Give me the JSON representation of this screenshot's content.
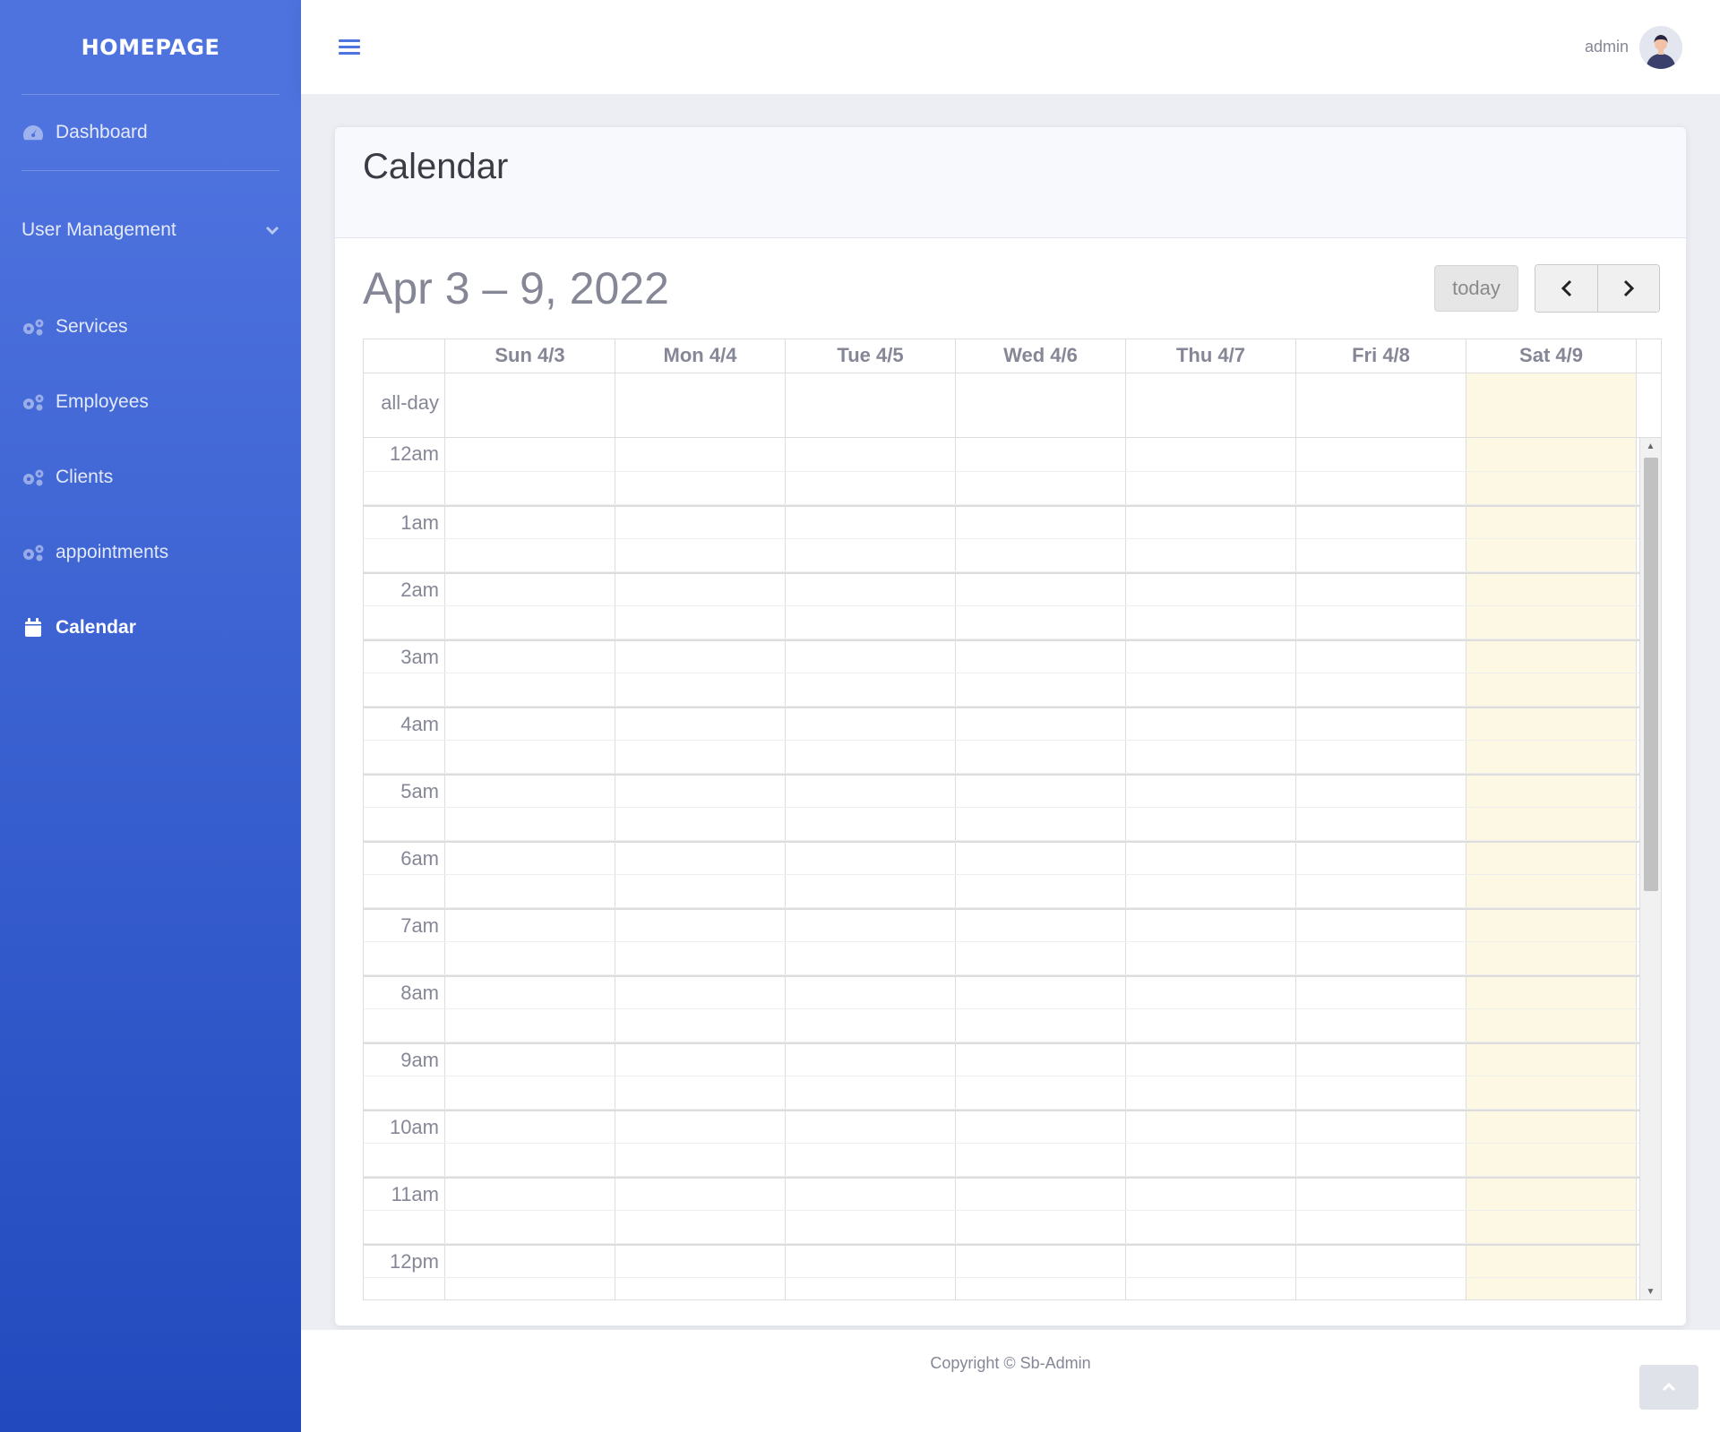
{
  "sidebar": {
    "brand": "HOMEPAGE",
    "items": [
      {
        "label": "Dashboard",
        "icon": "tachometer-icon"
      },
      {
        "label": "User Management",
        "icon": "chevron-down-icon"
      },
      {
        "label": "Services",
        "icon": "gears-icon"
      },
      {
        "label": "Employees",
        "icon": "gears-icon"
      },
      {
        "label": "Clients",
        "icon": "gears-icon"
      },
      {
        "label": "appointments",
        "icon": "gears-icon"
      },
      {
        "label": "Calendar",
        "icon": "calendar-icon",
        "active": true
      }
    ]
  },
  "topbar": {
    "menu_icon": "bars-icon",
    "user_name": "admin"
  },
  "page": {
    "title": "Calendar"
  },
  "calendar": {
    "range_title": "Apr 3 – 9, 2022",
    "today_label": "today",
    "prev_icon": "chevron-left-icon",
    "next_icon": "chevron-right-icon",
    "days": [
      "Sun 4/3",
      "Mon 4/4",
      "Tue 4/5",
      "Wed 4/6",
      "Thu 4/7",
      "Fri 4/8",
      "Sat 4/9"
    ],
    "today_index": 6,
    "allday_label": "all-day",
    "hours": [
      "12am",
      "1am",
      "2am",
      "3am",
      "4am",
      "5am",
      "6am",
      "7am",
      "8am",
      "9am",
      "10am",
      "11am",
      "12pm"
    ],
    "today_color": "#fcf8e3"
  },
  "footer": {
    "copyright": "Copyright © Sb-Admin"
  },
  "colors": {
    "primary": "#4e73df",
    "sidebar_end": "#224abe"
  }
}
